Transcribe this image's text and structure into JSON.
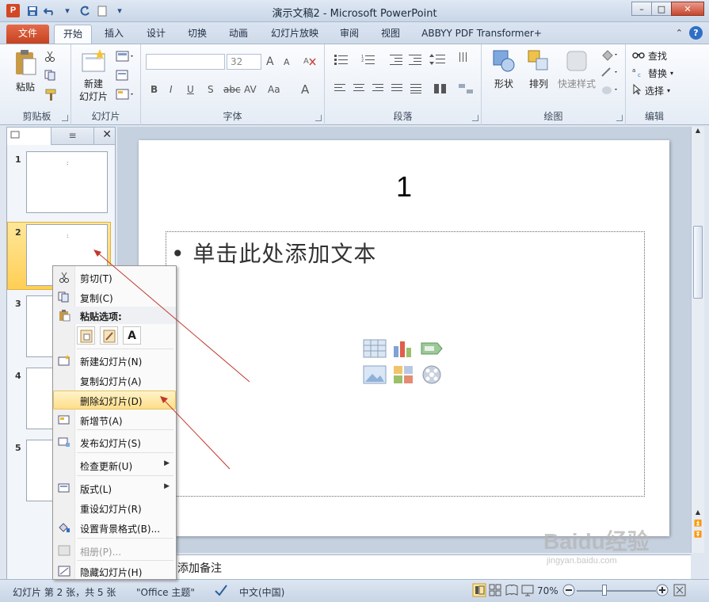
{
  "window": {
    "title": "演示文稿2 - Microsoft PowerPoint",
    "app_icon": "P"
  },
  "ribbon_tabs": [
    "文件",
    "开始",
    "插入",
    "设计",
    "切换",
    "动画",
    "幻灯片放映",
    "审阅",
    "视图",
    "ABBYY PDF Transformer+"
  ],
  "ribbon": {
    "clipboard": {
      "paste": "粘贴",
      "label": "剪贴板"
    },
    "slides": {
      "new_slide": "新建\n幻灯片",
      "new_slide_l1": "新建",
      "new_slide_l2": "幻灯片",
      "label": "幻灯片"
    },
    "font": {
      "size": "32",
      "label": "字体",
      "bold": "B",
      "italic": "I",
      "underline": "U",
      "strike": "S",
      "abc": "abc",
      "av": "AV",
      "aa": "Aa",
      "fontcolor": "A",
      "grow": "A",
      "shrink": "A"
    },
    "paragraph": {
      "label": "段落"
    },
    "drawing": {
      "shapes": "形状",
      "arrange": "排列",
      "quick_styles": "快速样式",
      "label": "绘图"
    },
    "editing": {
      "find": "查找",
      "replace": "替换",
      "select": "选择",
      "label": "编辑"
    }
  },
  "slides_pane": {
    "thumbnails": [
      "1",
      "2",
      "3",
      "4",
      "5"
    ],
    "selected": "2",
    "thumb_mark": ":"
  },
  "slide": {
    "title": "1",
    "bullet_text": "单击此处添加文本",
    "bullet_symbol": "•"
  },
  "notes": {
    "placeholder": "添加备注"
  },
  "context_menu": {
    "items": [
      {
        "label": "剪切(T)",
        "icon": "cut-icon"
      },
      {
        "label": "复制(C)",
        "icon": "copy-icon"
      },
      {
        "label": "粘贴选项:",
        "icon": "paste-icon"
      },
      {
        "label": "新建幻灯片(N)",
        "icon": "new-slide-icon"
      },
      {
        "label": "复制幻灯片(A)",
        "icon": ""
      },
      {
        "label": "删除幻灯片(D)",
        "icon": ""
      },
      {
        "label": "新增节(A)",
        "icon": "add-section-icon"
      },
      {
        "label": "发布幻灯片(S)",
        "icon": "publish-icon"
      },
      {
        "label": "检查更新(U)",
        "icon": ""
      },
      {
        "label": "版式(L)",
        "icon": "layout-icon"
      },
      {
        "label": "重设幻灯片(R)",
        "icon": ""
      },
      {
        "label": "设置背景格式(B)...",
        "icon": "background-icon"
      },
      {
        "label": "相册(P)...",
        "icon": "album-icon"
      },
      {
        "label": "隐藏幻灯片(H)",
        "icon": "hide-slide-icon"
      }
    ],
    "paste_options": [
      "",
      "",
      "A"
    ]
  },
  "status": {
    "slide_info": "幻灯片 第 2 张，共 5 张",
    "theme": "\"Office 主题\"",
    "language": "中文(中国)",
    "zoom": "70%"
  },
  "watermark": {
    "text": "Baidu经验",
    "sub": "jingyan.baidu.com"
  },
  "colors": {
    "file_tab": "#d24726",
    "selected_thumb": "#ffcf55",
    "menu_hover": "#ffde8a",
    "arrow": "#c0392b"
  }
}
